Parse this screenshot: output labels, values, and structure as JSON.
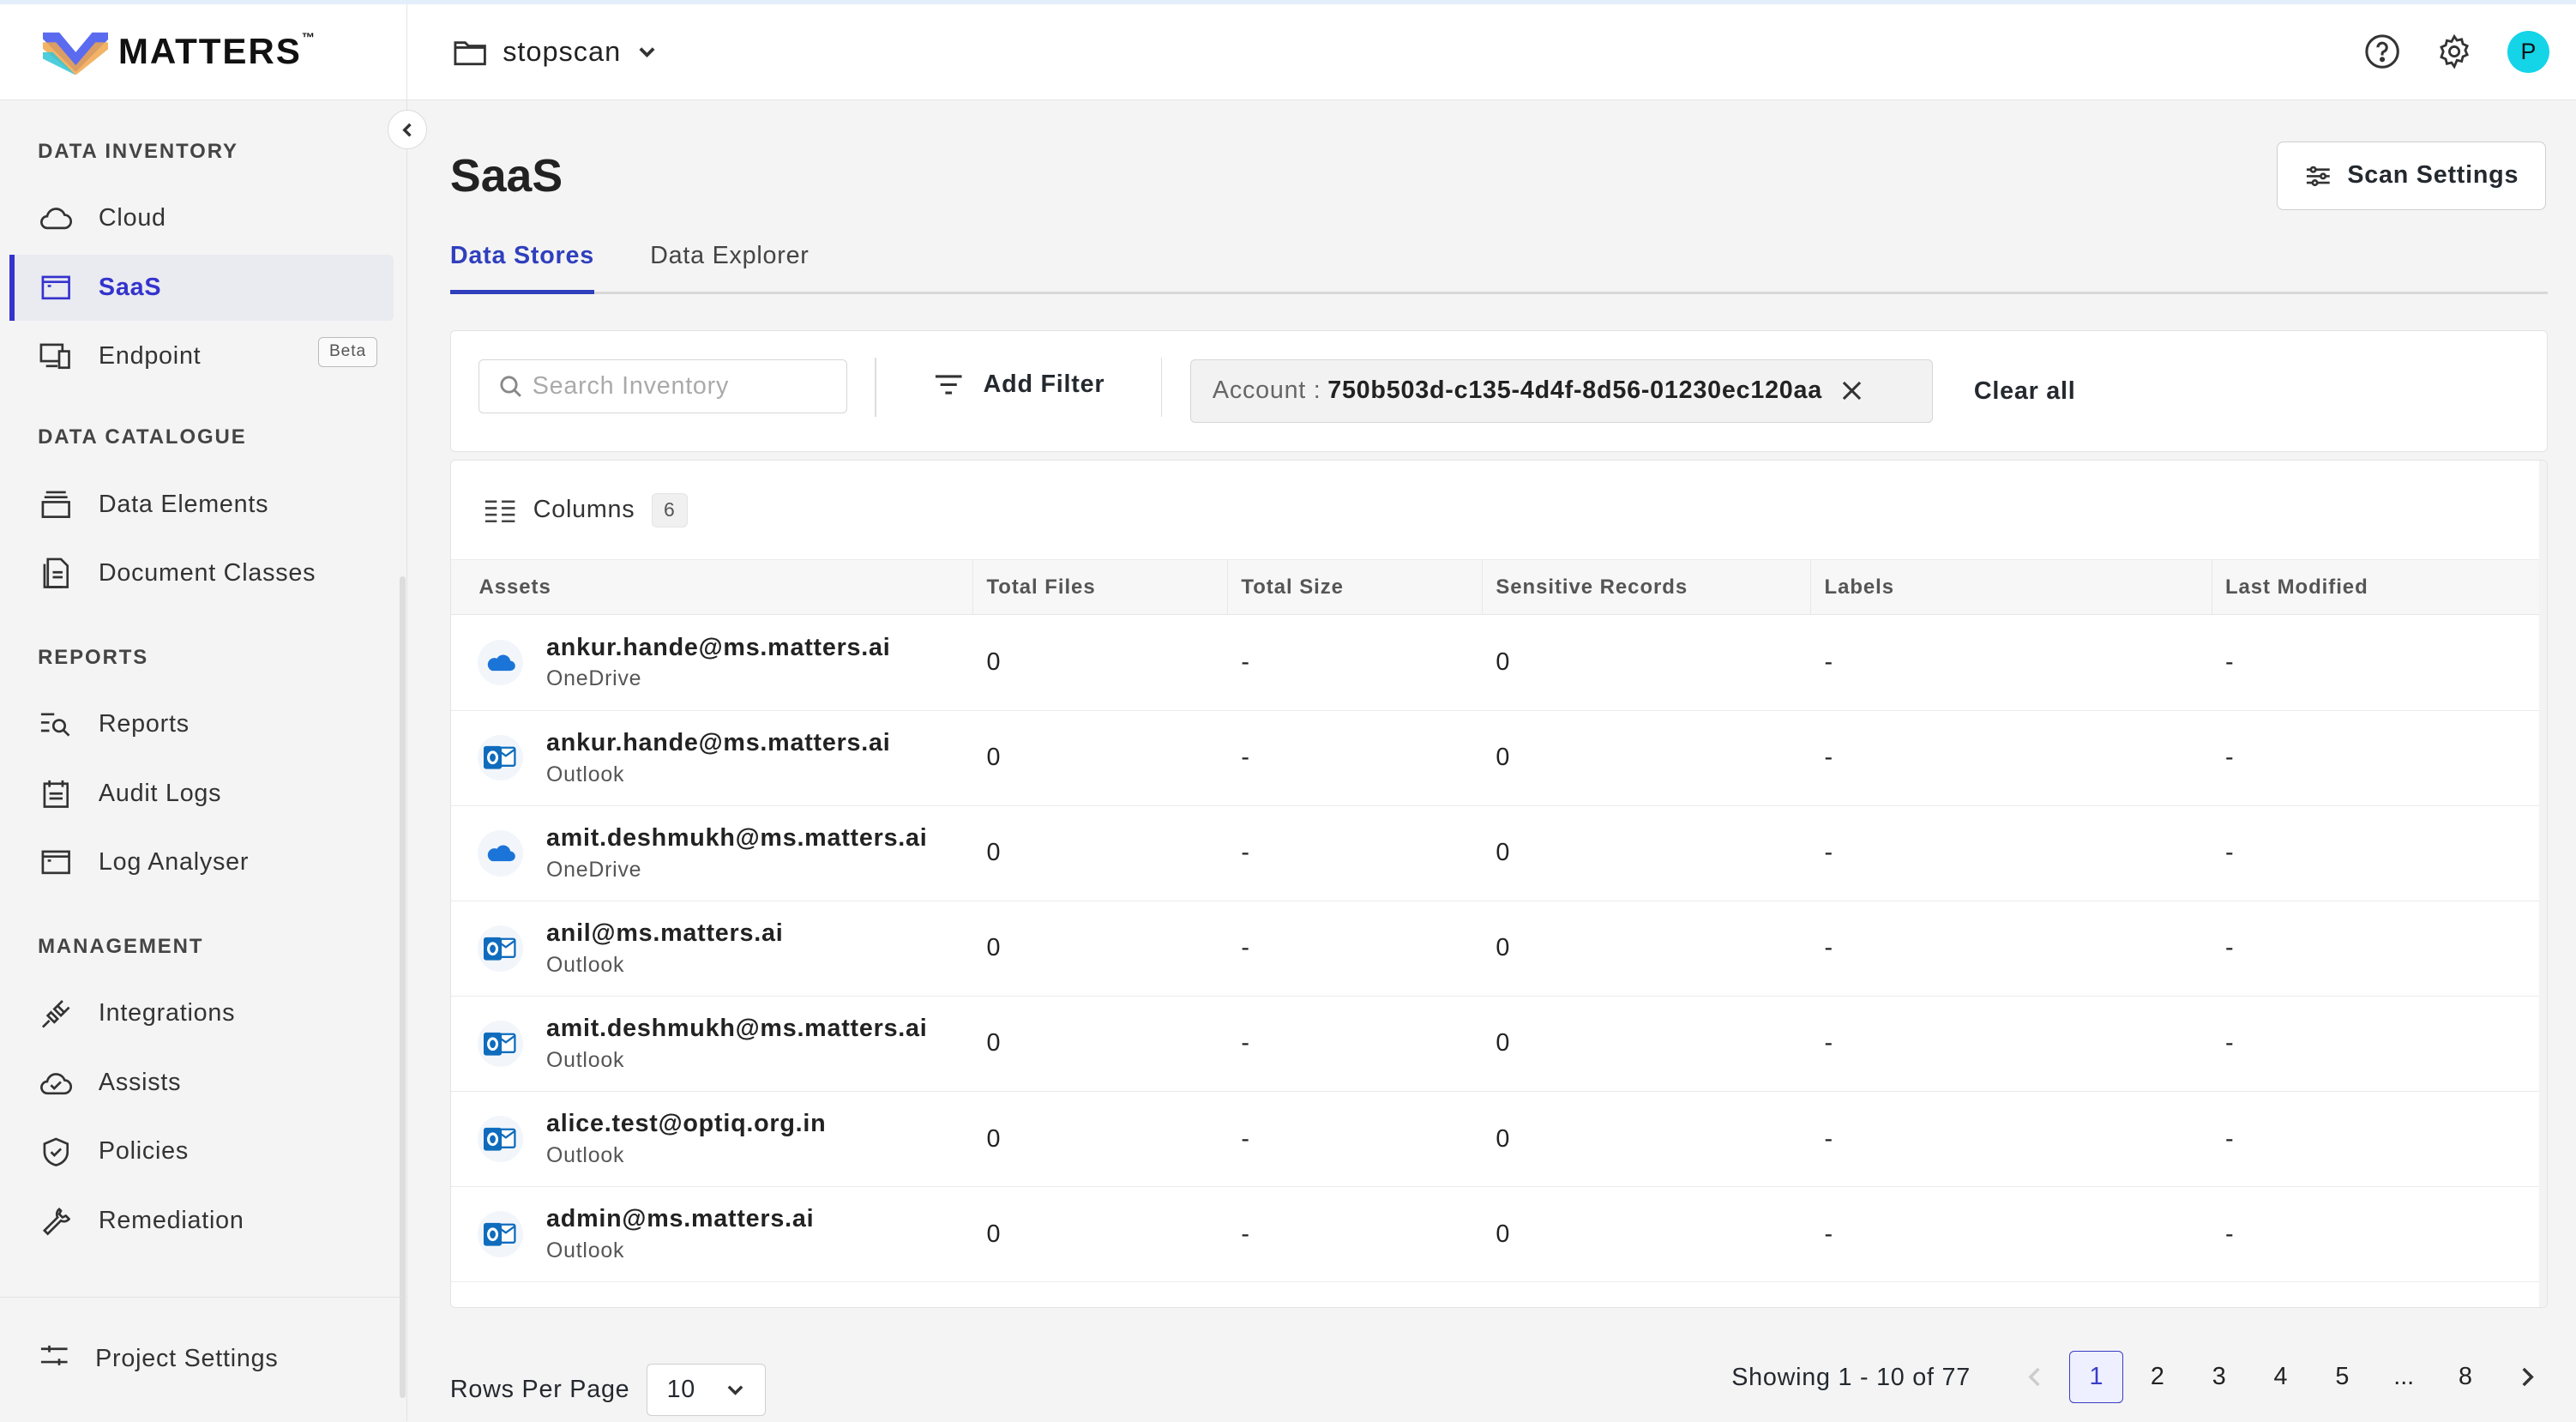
{
  "brand": {
    "name": "MATTERS",
    "tm": "™"
  },
  "project": {
    "name": "stopscan"
  },
  "user": {
    "initial": "P"
  },
  "sidebar": {
    "sections": [
      {
        "title": "DATA INVENTORY",
        "items": [
          {
            "label": "Cloud",
            "icon": "cloud-icon"
          },
          {
            "label": "SaaS",
            "icon": "window-icon",
            "active": true
          },
          {
            "label": "Endpoint",
            "icon": "devices-icon",
            "badge": "Beta"
          }
        ]
      },
      {
        "title": "DATA CATALOGUE",
        "items": [
          {
            "label": "Data Elements",
            "icon": "stack-icon"
          },
          {
            "label": "Document Classes",
            "icon": "documents-icon"
          }
        ]
      },
      {
        "title": "REPORTS",
        "items": [
          {
            "label": "Reports",
            "icon": "report-search-icon"
          },
          {
            "label": "Audit Logs",
            "icon": "calendar-icon"
          },
          {
            "label": "Log Analyser",
            "icon": "window-icon"
          }
        ]
      },
      {
        "title": "MANAGEMENT",
        "items": [
          {
            "label": "Integrations",
            "icon": "plug-icon"
          },
          {
            "label": "Assists",
            "icon": "check-cloud-icon"
          },
          {
            "label": "Policies",
            "icon": "shield-icon"
          },
          {
            "label": "Remediation",
            "icon": "wrench-icon"
          }
        ]
      }
    ],
    "footer": {
      "label": "Project Settings"
    }
  },
  "page": {
    "title": "SaaS",
    "scan_settings": "Scan Settings",
    "tabs": [
      {
        "label": "Data Stores"
      },
      {
        "label": "Data Explorer"
      }
    ]
  },
  "filters": {
    "search_placeholder": "Search Inventory",
    "add_filter": "Add Filter",
    "chip_key": "Account :",
    "chip_value": "750b503d-c135-4d4f-8d56-01230ec120aa",
    "clear_all": "Clear all"
  },
  "table": {
    "columns_label": "Columns",
    "columns_count": "6",
    "headers": [
      "Assets",
      "Total Files",
      "Total Size",
      "Sensitive Records",
      "Labels",
      "Last Modified"
    ],
    "rows": [
      {
        "name": "ankur.hande@ms.matters.ai",
        "source": "OneDrive",
        "files": "0",
        "size": "-",
        "sensitive": "0",
        "labels": "-",
        "modified": "-"
      },
      {
        "name": "ankur.hande@ms.matters.ai",
        "source": "Outlook",
        "files": "0",
        "size": "-",
        "sensitive": "0",
        "labels": "-",
        "modified": "-"
      },
      {
        "name": "amit.deshmukh@ms.matters.ai",
        "source": "OneDrive",
        "files": "0",
        "size": "-",
        "sensitive": "0",
        "labels": "-",
        "modified": "-"
      },
      {
        "name": "anil@ms.matters.ai",
        "source": "Outlook",
        "files": "0",
        "size": "-",
        "sensitive": "0",
        "labels": "-",
        "modified": "-"
      },
      {
        "name": "amit.deshmukh@ms.matters.ai",
        "source": "Outlook",
        "files": "0",
        "size": "-",
        "sensitive": "0",
        "labels": "-",
        "modified": "-"
      },
      {
        "name": "alice.test@optiq.org.in",
        "source": "Outlook",
        "files": "0",
        "size": "-",
        "sensitive": "0",
        "labels": "-",
        "modified": "-"
      },
      {
        "name": "admin@ms.matters.ai",
        "source": "Outlook",
        "files": "0",
        "size": "-",
        "sensitive": "0",
        "labels": "-",
        "modified": "-"
      }
    ]
  },
  "pagination": {
    "rows_per_page_label": "Rows Per Page",
    "rows_per_page": "10",
    "showing": "Showing 1 - 10 of 77",
    "pages": [
      "1",
      "2",
      "3",
      "4",
      "5",
      "...",
      "8"
    ],
    "current": "1"
  },
  "colors": {
    "accent": "#3533cd",
    "avatar": "#14d4e8",
    "onedrive": "#1b74d8",
    "outlook": "#0f6cbd"
  }
}
